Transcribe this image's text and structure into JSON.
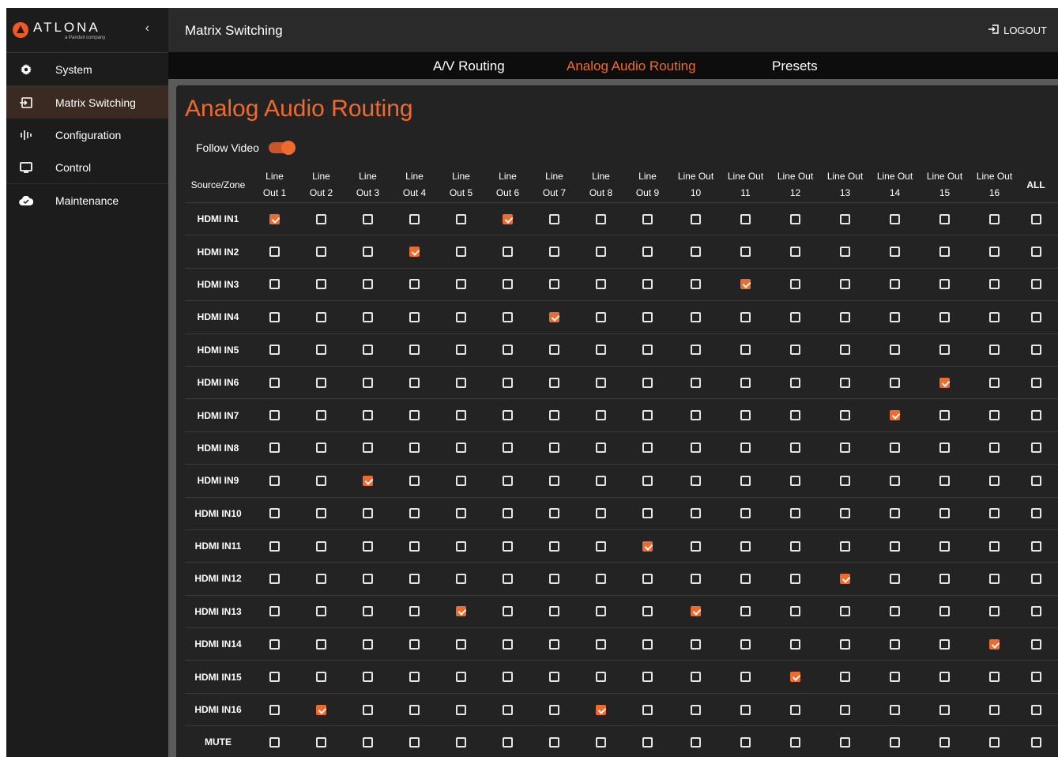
{
  "brand": {
    "name": "ATLONA",
    "sub": "a Panduit company",
    "collapse_glyph": "‹"
  },
  "sidebar": {
    "items": [
      {
        "label": "System",
        "icon": "gear-icon"
      },
      {
        "label": "Matrix Switching",
        "icon": "switch-icon",
        "active": true
      },
      {
        "label": "Configuration",
        "icon": "sliders-icon"
      },
      {
        "label": "Control",
        "icon": "monitor-icon"
      },
      {
        "label": "Maintenance",
        "icon": "cloud-icon"
      }
    ]
  },
  "header": {
    "title": "Matrix Switching",
    "logout_label": "LOGOUT"
  },
  "tabs": [
    {
      "label": "A/V Routing",
      "active": false
    },
    {
      "label": "Analog Audio Routing",
      "active": true
    },
    {
      "label": "Presets",
      "active": false
    }
  ],
  "page": {
    "title": "Analog Audio Routing",
    "follow_video_label": "Follow Video",
    "follow_video_on": true
  },
  "colors": {
    "accent": "#ef6a2e",
    "background": "#232323",
    "sidebar": "#1c1c1c",
    "active_nav": "#3a2a22"
  },
  "matrix": {
    "corner_label": "Source/Zone",
    "all_label": "ALL",
    "columns": [
      {
        "line1": "Line",
        "line2": "Out 1"
      },
      {
        "line1": "Line",
        "line2": "Out 2"
      },
      {
        "line1": "Line",
        "line2": "Out 3"
      },
      {
        "line1": "Line",
        "line2": "Out 4"
      },
      {
        "line1": "Line",
        "line2": "Out 5"
      },
      {
        "line1": "Line",
        "line2": "Out 6"
      },
      {
        "line1": "Line",
        "line2": "Out 7"
      },
      {
        "line1": "Line",
        "line2": "Out 8"
      },
      {
        "line1": "Line",
        "line2": "Out 9"
      },
      {
        "line1": "Line Out",
        "line2": "10"
      },
      {
        "line1": "Line Out",
        "line2": "11"
      },
      {
        "line1": "Line Out",
        "line2": "12"
      },
      {
        "line1": "Line Out",
        "line2": "13"
      },
      {
        "line1": "Line Out",
        "line2": "14"
      },
      {
        "line1": "Line Out",
        "line2": "15"
      },
      {
        "line1": "Line Out",
        "line2": "16"
      }
    ],
    "rows": [
      {
        "label": "HDMI IN1",
        "checked": [
          1,
          6
        ]
      },
      {
        "label": "HDMI IN2",
        "checked": [
          4
        ]
      },
      {
        "label": "HDMI IN3",
        "checked": [
          11
        ]
      },
      {
        "label": "HDMI IN4",
        "checked": [
          7
        ]
      },
      {
        "label": "HDMI IN5",
        "checked": []
      },
      {
        "label": "HDMI IN6",
        "checked": [
          15
        ]
      },
      {
        "label": "HDMI IN7",
        "checked": [
          14
        ]
      },
      {
        "label": "HDMI IN8",
        "checked": []
      },
      {
        "label": "HDMI IN9",
        "checked": [
          3
        ]
      },
      {
        "label": "HDMI IN10",
        "checked": []
      },
      {
        "label": "HDMI IN11",
        "checked": [
          9
        ]
      },
      {
        "label": "HDMI IN12",
        "checked": [
          13
        ]
      },
      {
        "label": "HDMI IN13",
        "checked": [
          5,
          10
        ]
      },
      {
        "label": "HDMI IN14",
        "checked": [
          16
        ]
      },
      {
        "label": "HDMI IN15",
        "checked": [
          12
        ]
      },
      {
        "label": "HDMI IN16",
        "checked": [
          2,
          8
        ]
      },
      {
        "label": "MUTE",
        "checked": []
      }
    ]
  }
}
